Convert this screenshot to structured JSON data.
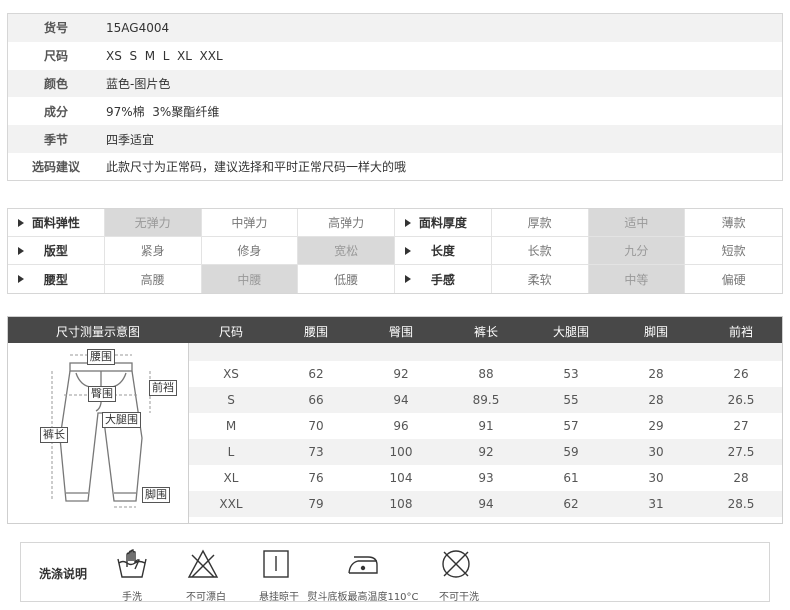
{
  "info": [
    {
      "label": "货号",
      "value": "15AG4004"
    },
    {
      "label": "尺码",
      "value": "XS  S  M  L  XL  XXL"
    },
    {
      "label": "颜色",
      "value": "蓝色-图片色"
    },
    {
      "label": "成分",
      "value": "97%棉  3%聚酯纤维"
    },
    {
      "label": "季节",
      "value": "四季适宜"
    },
    {
      "label": "选码建议",
      "value": "此款尺寸为正常码，建议选择和平时正常尺码一样大的哦"
    }
  ],
  "attributes": [
    {
      "left": {
        "name": "面料弹性",
        "options": [
          "无弹力",
          "中弹力",
          "高弹力"
        ],
        "selected": 0
      },
      "right": {
        "name": "面料厚度",
        "options": [
          "厚款",
          "适中",
          "薄款"
        ],
        "selected": 1
      }
    },
    {
      "left": {
        "name": "版型",
        "options": [
          "紧身",
          "修身",
          "宽松"
        ],
        "selected": 2
      },
      "right": {
        "name": "长度",
        "options": [
          "长款",
          "九分",
          "短款"
        ],
        "selected": 1
      }
    },
    {
      "left": {
        "name": "腰型",
        "options": [
          "高腰",
          "中腰",
          "低腰"
        ],
        "selected": 1
      },
      "right": {
        "name": "手感",
        "options": [
          "柔软",
          "中等",
          "偏硬"
        ],
        "selected": 1
      }
    }
  ],
  "size_chart": {
    "diagram_title": "尺寸测量示意图",
    "headers": [
      "尺码",
      "腰围",
      "臀围",
      "裤长",
      "大腿围",
      "脚围",
      "前裆"
    ],
    "rows": [
      [
        "XS",
        "62",
        "92",
        "88",
        "53",
        "28",
        "26"
      ],
      [
        "S",
        "66",
        "94",
        "89.5",
        "55",
        "28",
        "26.5"
      ],
      [
        "M",
        "70",
        "96",
        "91",
        "57",
        "29",
        "27"
      ],
      [
        "L",
        "73",
        "100",
        "92",
        "59",
        "30",
        "27.5"
      ],
      [
        "XL",
        "76",
        "104",
        "93",
        "61",
        "30",
        "28"
      ],
      [
        "XXL",
        "79",
        "108",
        "94",
        "62",
        "31",
        "28.5"
      ]
    ],
    "diagram_labels": {
      "waist": "腰围",
      "hip": "臀围",
      "front_rise": "前裆",
      "thigh": "大腿围",
      "length": "裤长",
      "hem": "脚围"
    }
  },
  "care": {
    "title": "洗涤说明",
    "items": [
      {
        "icon": "hand-wash-icon",
        "label": "手洗"
      },
      {
        "icon": "no-bleach-icon",
        "label": "不可漂白"
      },
      {
        "icon": "hang-dry-icon",
        "label": "悬挂晾干"
      },
      {
        "icon": "iron-icon",
        "label": "熨斗底板最高温度110°C"
      },
      {
        "icon": "no-dry-clean-icon",
        "label": "不可干洗"
      }
    ]
  }
}
